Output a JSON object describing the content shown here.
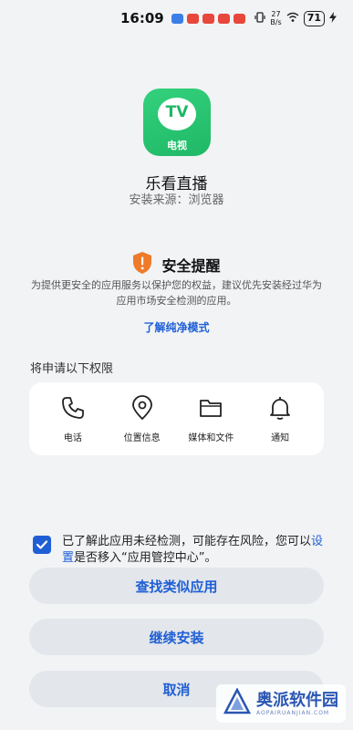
{
  "status_bar": {
    "time": "16:09",
    "net_speed_value": "27",
    "net_speed_unit": "B/s",
    "battery": "71"
  },
  "app": {
    "icon_badge": "TV",
    "icon_label": "电视",
    "name": "乐看直播",
    "source": "安装来源：浏览器"
  },
  "security": {
    "title": "安全提醒",
    "description": "为提供更安全的应用服务以保护您的权益，建议优先安装经过华为应用市场安全检测的应用。",
    "link": "了解纯净模式"
  },
  "permissions": {
    "title": "将申请以下权限",
    "items": [
      {
        "label": "电话",
        "icon": "phone-icon"
      },
      {
        "label": "位置信息",
        "icon": "location-icon"
      },
      {
        "label": "媒体和文件",
        "icon": "folder-icon"
      },
      {
        "label": "通知",
        "icon": "bell-icon"
      }
    ]
  },
  "consent": {
    "checked": true,
    "text_before": "已了解此应用未经检测，可能存在风险，您可以",
    "link": "设置",
    "text_after": "是否移入“应用管控中心”。"
  },
  "buttons": {
    "find_similar": "查找类似应用",
    "continue": "继续安装",
    "cancel": "取消"
  },
  "watermark": {
    "text": "奥派软件园",
    "sub": "AOPAIRUANJIAN.COM"
  },
  "colors": {
    "accent": "#1f5fd6",
    "shield": "#ef7a2a",
    "app_green": "#1fb866"
  }
}
